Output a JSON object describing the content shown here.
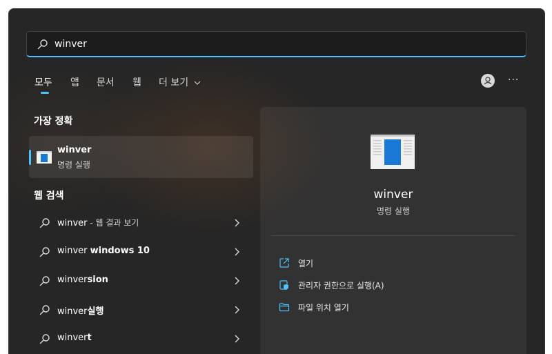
{
  "search": {
    "value": "winver"
  },
  "tabs": [
    {
      "label": "모두"
    },
    {
      "label": "앱"
    },
    {
      "label": "문서"
    },
    {
      "label": "웹"
    },
    {
      "label": "더 보기"
    }
  ],
  "header": {
    "more_label": "···"
  },
  "best_match": {
    "heading": "가장 정확",
    "title": "winver",
    "subtitle": "명령 실행"
  },
  "web_search": {
    "heading": "웹 검색",
    "items": [
      {
        "prefix": "winver",
        "bold": "",
        "suffix": " - 웹 결과 보기"
      },
      {
        "prefix": "winver ",
        "bold": "windows 10",
        "suffix": ""
      },
      {
        "prefix": "winver",
        "bold": "sion",
        "suffix": ""
      },
      {
        "prefix": "winver",
        "bold": "실행",
        "suffix": ""
      },
      {
        "prefix": "winver",
        "bold": "t",
        "suffix": ""
      }
    ]
  },
  "detail": {
    "title": "winver",
    "subtitle": "명령 실행",
    "actions": [
      {
        "label": "열기",
        "icon": "open-icon"
      },
      {
        "label": "관리자 권한으로 실행(A)",
        "icon": "admin-shield-icon"
      },
      {
        "label": "파일 위치 열기",
        "icon": "folder-icon"
      }
    ]
  },
  "colors": {
    "accent": "#4cc2ff",
    "panel": "#262626"
  }
}
